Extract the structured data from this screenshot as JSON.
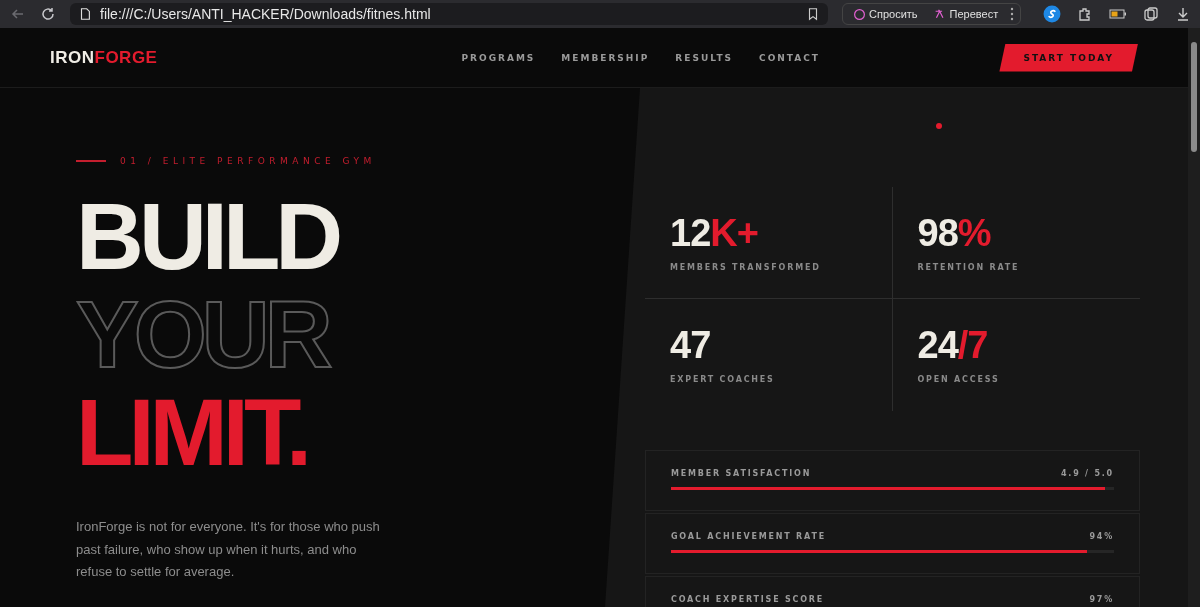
{
  "browser": {
    "url": "file:///C:/Users/ANTI_HACKER/Downloads/fitnes.html",
    "ask_label": "Спросить",
    "translate_label": "Перевест"
  },
  "nav": {
    "brand_main": "IRON",
    "brand_accent": "FORGE",
    "links": [
      "PROGRAMS",
      "MEMBERSHIP",
      "RESULTS",
      "CONTACT"
    ],
    "cta": "START TODAY"
  },
  "hero": {
    "eyebrow": "01 / ELITE PERFORMANCE GYM",
    "headline": [
      {
        "text": "BUILD",
        "kind": "solid"
      },
      {
        "text": "YOUR",
        "kind": "outline"
      },
      {
        "text": "LIMIT.",
        "kind": "accent"
      }
    ],
    "description": "IronForge is not for everyone. It's for those who push past failure, who show up when it hurts, and who refuse to settle for average."
  },
  "stats": [
    {
      "number": "12",
      "accent": "K+",
      "label": "MEMBERS TRANSFORMED"
    },
    {
      "number": "98",
      "accent": "%",
      "label": "RETENTION RATE"
    },
    {
      "number": "47",
      "label": "EXPERT COACHES"
    },
    {
      "number": "24",
      "accent": "/7",
      "label": "OPEN ACCESS"
    }
  ],
  "metrics": [
    {
      "label": "MEMBER SATISFACTION",
      "reading": "4.9 / 5.0",
      "level": 0.98
    },
    {
      "label": "GOAL ACHIEVEMENT RATE",
      "reading": "94%",
      "level": 0.94
    },
    {
      "label": "COACH EXPERTISE SCORE",
      "reading": "97%"
    }
  ]
}
